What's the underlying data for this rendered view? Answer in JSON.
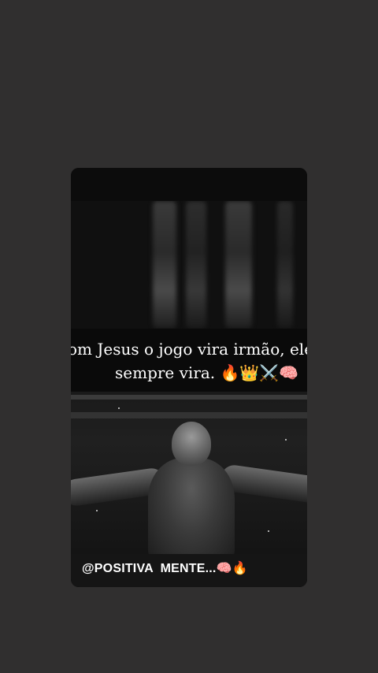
{
  "story": {
    "caption_line1": "om Jesus o jogo vira irmão, ele",
    "caption_line2": "sempre vira. 🔥👑⚔️🧠",
    "handle": "@POSITIVA  MENTE...🧠🔥"
  }
}
